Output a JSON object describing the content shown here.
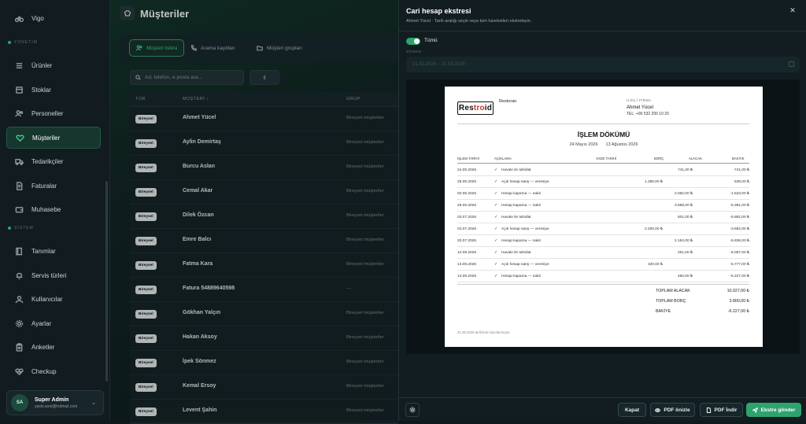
{
  "sidebar": {
    "top_item": "Vigo",
    "section_yonetim": "YÖNETİM",
    "section_sistem": "SİSTEM",
    "items": [
      {
        "label": "Ürünler",
        "icon": "list-icon"
      },
      {
        "label": "Stoklar",
        "icon": "box-icon"
      },
      {
        "label": "Personeller",
        "icon": "users-icon"
      },
      {
        "label": "Müşteriler",
        "icon": "heart-icon"
      },
      {
        "label": "Tedarikçiler",
        "icon": "truck-icon"
      },
      {
        "label": "Faturalar",
        "icon": "file-icon"
      },
      {
        "label": "Muhasebe",
        "icon": "wallet-icon"
      },
      {
        "label": "Tanımlar",
        "icon": "book-icon"
      },
      {
        "label": "Servis türleri",
        "icon": "bell-icon"
      },
      {
        "label": "Kullanıcılar",
        "icon": "user-icon"
      },
      {
        "label": "Ayarlar",
        "icon": "gear-icon"
      },
      {
        "label": "Anketler",
        "icon": "clipboard-icon"
      },
      {
        "label": "Checkup",
        "icon": "heart-pulse-icon"
      }
    ],
    "user": {
      "initials": "SA",
      "name": "Super Admin",
      "email": "yasin.sooi@hotmail.com"
    }
  },
  "main": {
    "title": "Müşteriler",
    "tabs": [
      "Müşteri listesi",
      "Arama kayıtları",
      "Müşteri grupları"
    ],
    "search_placeholder": "Ad, telefon, e-posta ara...",
    "sort_glyph": "⇕",
    "columns": [
      "TÜR",
      "MÜŞTERİ ↑",
      "GRUP"
    ],
    "rows": [
      {
        "type": "Bireysel",
        "name": "Ahmet Yücel",
        "group": "Bireysel müşteriler"
      },
      {
        "type": "Bireysel",
        "name": "Aylin Demirtaş",
        "group": "Bireysel müşteriler"
      },
      {
        "type": "Bireysel",
        "name": "Burcu Aslan",
        "group": "Bireysel müşteriler"
      },
      {
        "type": "Bireysel",
        "name": "Cemal Akar",
        "group": "Bireysel müşteriler"
      },
      {
        "type": "Bireysel",
        "name": "Dilek Özcan",
        "group": "Bireysel müşteriler"
      },
      {
        "type": "Bireysel",
        "name": "Emre Balcı",
        "group": "Bireysel müşteriler"
      },
      {
        "type": "Bireysel",
        "name": "Fatma Kara",
        "group": "Bireysel müşteriler"
      },
      {
        "type": "Bireysel",
        "name": "Fatura 54889640598",
        "group": "—"
      },
      {
        "type": "Bireysel",
        "name": "Gökhan Yalçın",
        "group": "Bireysel müşteriler"
      },
      {
        "type": "Bireysel",
        "name": "Hakan Aksoy",
        "group": "Bireysel müşteriler"
      },
      {
        "type": "Bireysel",
        "name": "İpek Sönmez",
        "group": "Bireysel müşteriler"
      },
      {
        "type": "Bireysel",
        "name": "Kemal Ersoy",
        "group": "Bireysel müşteriler"
      },
      {
        "type": "Bireysel",
        "name": "Levent Şahin",
        "group": "Bireysel müşteriler"
      }
    ]
  },
  "panel": {
    "title": "Cari hesap ekstresi",
    "subtitle": "Ahmet Yücel · Tarih aralığı seçin veya tüm hareketleri ekstreleyin.",
    "close": "✕",
    "toggle_label": "Tümü",
    "period_label": "DÖNEM",
    "period_value": "21.02.2026 – 21.08.2026",
    "buttons": {
      "close": "Kapat",
      "preview": "PDF önizle",
      "download": "PDF İndir",
      "send": "Ekstre gönder"
    }
  },
  "document": {
    "logo_left": "Res",
    "logo_mid": "tro",
    "logo_right": "id",
    "company": "Restoran",
    "related_label": "İLGİLİ FİRMA",
    "related_name": "Ahmet Yücel",
    "related_tel": "TEL: +90 532 200 10 20",
    "title": "İŞLEM DÖKÜMÜ",
    "date_from": "24 Mayıs 2026",
    "date_to": "13 Ağustos 2026",
    "headers": [
      "İŞLEM TARİHİ",
      "AÇIKLAMA",
      "VADE TARİHİ",
      "BORÇ",
      "ALACAK",
      "BAKİYE"
    ],
    "rows": [
      {
        "date": "24.05.2026",
        "desc": "Havale ile tahsilat",
        "due": "",
        "debit": "",
        "credit": "741,00 ₺",
        "balance": "-741,00 ₺"
      },
      {
        "date": "25.05.2026",
        "desc": "Açık hesap satış — veresiye",
        "due": "",
        "debit": "1.280,00 ₺",
        "credit": "",
        "balance": "539,00 ₺"
      },
      {
        "date": "02.06.2026",
        "desc": "Hesap kapama — nakit",
        "due": "",
        "debit": "",
        "credit": "2.062,00 ₺",
        "balance": "-1.523,00 ₺"
      },
      {
        "date": "26.06.2026",
        "desc": "Hesap kapama — nakit",
        "due": "",
        "debit": "",
        "credit": "3.858,00 ₺",
        "balance": "-5.381,00 ₺"
      },
      {
        "date": "03.07.2026",
        "desc": "Havale ile tahsilat",
        "due": "",
        "debit": "",
        "credit": "501,00 ₺",
        "balance": "-5.882,00 ₺"
      },
      {
        "date": "04.07.2026",
        "desc": "Açık hesap satış — veresiye",
        "due": "",
        "debit": "2.200,00 ₺",
        "credit": "",
        "balance": "-3.682,00 ₺"
      },
      {
        "date": "20.07.2026",
        "desc": "Hesap kapama — nakit",
        "due": "",
        "debit": "",
        "credit": "2.154,00 ₺",
        "balance": "-5.836,00 ₺"
      },
      {
        "date": "12.08.2026",
        "desc": "Havale ile tahsilat",
        "due": "",
        "debit": "",
        "credit": "261,00 ₺",
        "balance": "-6.097,00 ₺"
      },
      {
        "date": "13.08.2026",
        "desc": "Açık hesap satış — veresiye",
        "due": "",
        "debit": "320,00 ₺",
        "credit": "",
        "balance": "-5.777,00 ₺"
      },
      {
        "date": "13.08.2026",
        "desc": "Hesap kapama — nakit",
        "due": "",
        "debit": "",
        "credit": "450,00 ₺",
        "balance": "-6.227,00 ₺"
      }
    ],
    "totals": [
      {
        "label": "TOPLAM ALACAK",
        "value": "10.027,00 ₺"
      },
      {
        "label": "TOPLAM BORÇ",
        "value": "3.800,00 ₺"
      },
      {
        "label": "BAKİYE",
        "value": "-6.227,00 ₺"
      }
    ],
    "footer": "21.08.2026 tarihinde hazırlanmıştır."
  }
}
